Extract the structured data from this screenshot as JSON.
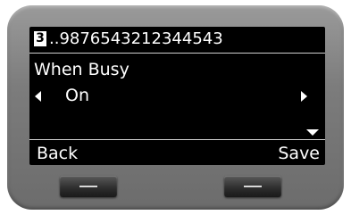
{
  "header": {
    "line_number": "3",
    "title": "..9876543212344543"
  },
  "setting": {
    "label": "When Busy",
    "value": "On"
  },
  "softkeys": {
    "left_label": "Back",
    "right_label": "Save"
  },
  "icons": {
    "prev": "arrow-left-icon",
    "next": "arrow-right-icon",
    "more": "arrow-down-icon"
  },
  "colors": {
    "screen_bg": "#000000",
    "text": "#ffffff",
    "device_body": "#7c7c7c",
    "key": "#2c2c2c"
  }
}
